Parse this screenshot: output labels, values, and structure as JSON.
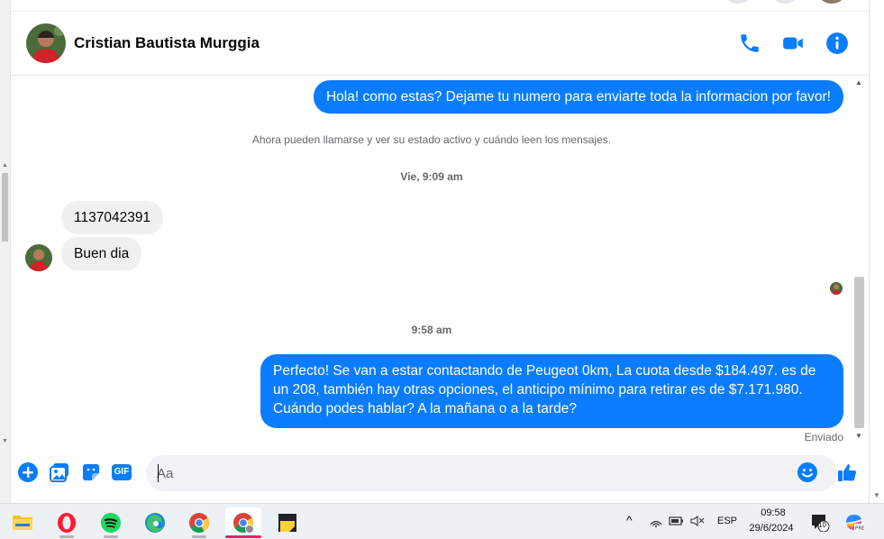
{
  "header": {
    "contact_name": "Cristian Bautista Murggia"
  },
  "messages": {
    "outgoing_1": "Hola! como estas? Dejame tu numero para enviarte toda la informacion por favor!",
    "system_notice": "Ahora pueden llamarse y ver su estado activo y cuándo leen los mensajes.",
    "timestamp_1": "Vie, 9:09 am",
    "incoming_1": "1137042391",
    "incoming_2": "Buen dia",
    "timestamp_2": "9:58 am",
    "outgoing_2": "Perfecto!  Se van a estar contactando de Peugeot 0km, La cuota desde $184.497. es de un 208, también hay otras opciones, el anticipo mínimo para retirar es de $7.171.980. Cuándo podes hablar? A la mañana o a la tarde?",
    "status": "Enviado"
  },
  "composer": {
    "placeholder": "Aa",
    "gif_label": "GIF"
  },
  "taskbar": {
    "apps": [
      "file-explorer",
      "opera",
      "spotify",
      "edge",
      "chrome",
      "chrome-profile",
      "sticky-notes"
    ],
    "language": "ESP",
    "time": "09:58",
    "date": "29/6/2024",
    "notification_count": "10"
  },
  "colors": {
    "messenger_blue": "#0a7cff",
    "incoming_bubble": "#f0f0f0",
    "taskbar_bg": "#eef1f4"
  }
}
